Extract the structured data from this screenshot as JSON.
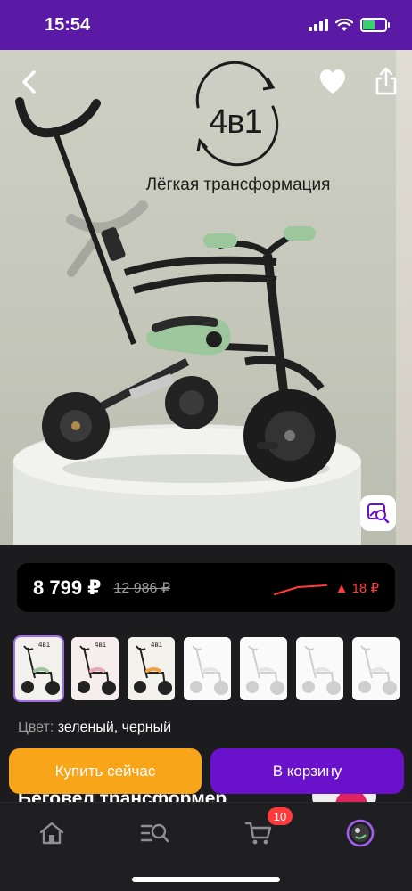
{
  "status_bar": {
    "time": "15:54"
  },
  "hero": {
    "badge_title": "4в1",
    "badge_subtitle": "Лёгкая трансформация",
    "image_subject": "green and black children's tricycle on a white pedestal",
    "accent_color": "#9cc79c"
  },
  "price": {
    "current": "8 799 ₽",
    "old": "12 986 ₽",
    "change": "▲ 18 ₽",
    "change_color": "#ff3b3b"
  },
  "thumbnails": [
    {
      "label": "4в1",
      "selected": true
    },
    {
      "label": "4в1",
      "selected": false
    },
    {
      "label": "4в1",
      "selected": false
    },
    {
      "label": "",
      "selected": false
    },
    {
      "label": "",
      "selected": false
    },
    {
      "label": "",
      "selected": false
    },
    {
      "label": "",
      "selected": false
    }
  ],
  "color": {
    "label": "Цвет:",
    "value": "зеленый, черный"
  },
  "title_peek": "Беговел трансформер",
  "actions": {
    "buy_now": "Купить сейчас",
    "add_to_cart": "В корзину",
    "buy_color": "#f8a51a",
    "cart_color": "#6a11cb"
  },
  "bottom_nav": {
    "cart_count": "10",
    "items": [
      "home-icon",
      "catalog-search-icon",
      "cart-icon",
      "profile-icon"
    ]
  },
  "brand_color": "#5a1aa6"
}
